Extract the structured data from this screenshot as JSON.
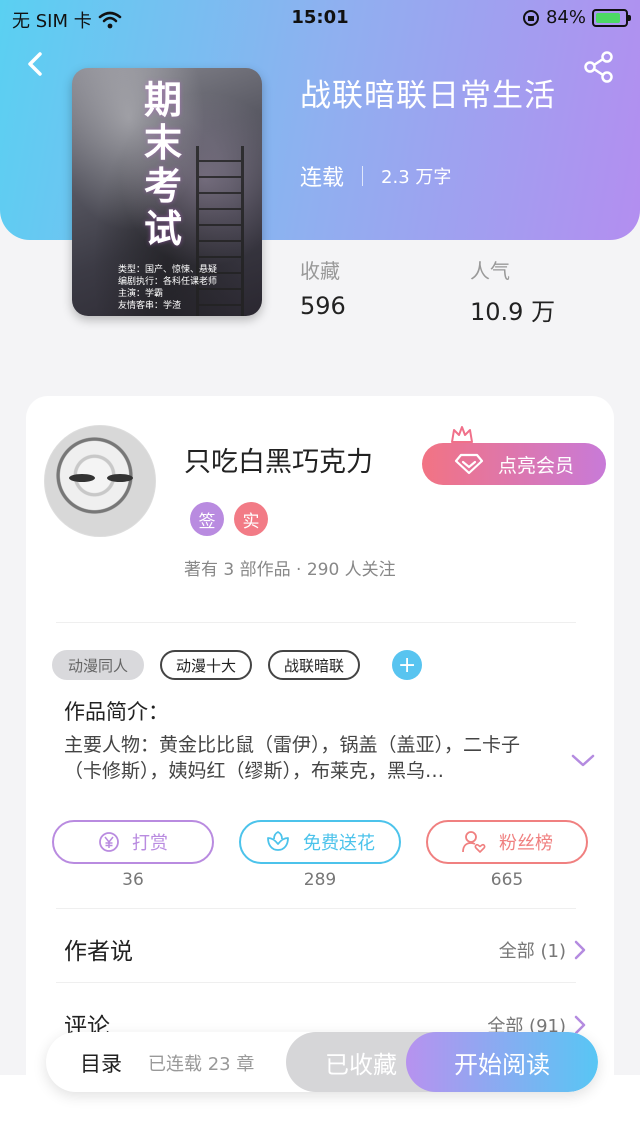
{
  "status_bar": {
    "carrier": "无 SIM 卡",
    "time": "15:01",
    "battery": "84%",
    "battery_level": 0.84
  },
  "book": {
    "title": "战联暗联日常生活",
    "serial_status": "连载",
    "word_count": "2.3 万字",
    "cover": {
      "title": "期末考试",
      "meta_lines": [
        "类型：国产、惊悚、悬疑",
        "编剧执行：各科任课老师",
        "主演：学霸",
        "友情客串：学渣"
      ]
    }
  },
  "stats": [
    {
      "label": "收藏",
      "value": "596"
    },
    {
      "label": "人气",
      "value": "10.9 万"
    }
  ],
  "author": {
    "name": "只吃白黑巧克力",
    "vip_button": "点亮会员",
    "badges": [
      {
        "label": "签",
        "color": "#b98be0"
      },
      {
        "label": "实",
        "color": "#f27b86"
      }
    ],
    "summary": "著有 3 部作品 · 290 人关注"
  },
  "tags": [
    "动漫同人",
    "动漫十大",
    "战联暗联"
  ],
  "tag_add": "+",
  "intro": {
    "title": "作品简介：",
    "text": "主要人物：黄金比比鼠（雷伊），锅盖（盖亚），二卡子（卡修斯），姨妈红（缪斯），布莱克，黑乌…"
  },
  "actions": [
    {
      "label": "打赏",
      "count": "36",
      "color": "#b98be0",
      "icon": "yen-coin-icon"
    },
    {
      "label": "免费送花",
      "count": "289",
      "color": "#4cc3eb",
      "icon": "flower-icon"
    },
    {
      "label": "粉丝榜",
      "count": "665",
      "color": "#f08080",
      "icon": "user-heart-icon"
    }
  ],
  "rows": [
    {
      "title": "作者说",
      "right": "全部 (1)"
    },
    {
      "title": "评论",
      "right": "全部 (91)"
    }
  ],
  "bottom_bar": {
    "catalog": "目录",
    "chapters": "已连载 23 章",
    "favorited": "已收藏",
    "start_reading": "开始阅读"
  }
}
